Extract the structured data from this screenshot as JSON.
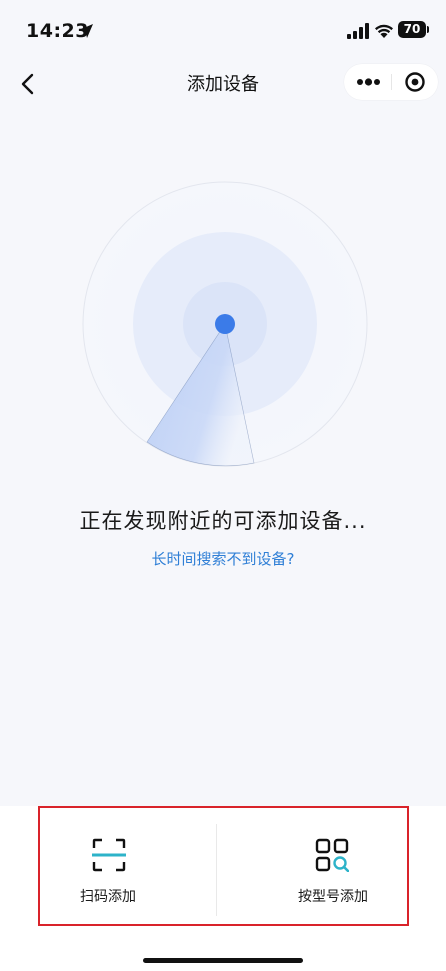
{
  "status_bar": {
    "time": "14:23",
    "battery": "70",
    "icons": [
      "location-arrow-icon",
      "cellular-signal-icon",
      "wifi-icon",
      "battery-icon"
    ]
  },
  "nav": {
    "title": "添加设备",
    "back_icon": "chevron-left-icon",
    "more_icon": "more-dots-icon",
    "close_icon": "target-close-icon"
  },
  "main": {
    "searching_text": "正在发现附近的可添加设备...",
    "help_link": "长时间搜索不到设备?"
  },
  "bottom_options": [
    {
      "label": "扫码添加",
      "icon": "scan-frame-icon"
    },
    {
      "label": "按型号添加",
      "icon": "grid-search-icon"
    }
  ],
  "colors": {
    "accent": "#2f7fd6",
    "radar_dot": "#3b7be8",
    "highlight": "#d9232a",
    "scan_line": "#2db3c9"
  }
}
